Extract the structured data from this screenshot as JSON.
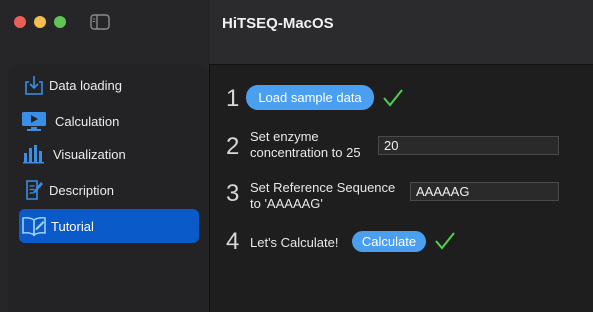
{
  "app": {
    "title": "HiTSEQ-MacOS"
  },
  "sidebar": {
    "items": [
      {
        "label": "Data loading",
        "icon": "download-icon"
      },
      {
        "label": "Calculation",
        "icon": "monitor-play-icon"
      },
      {
        "label": "Visualization",
        "icon": "bar-chart-icon"
      },
      {
        "label": "Description",
        "icon": "document-edit-icon"
      },
      {
        "label": "Tutorial",
        "icon": "open-book-icon",
        "active": true
      }
    ]
  },
  "steps": [
    {
      "number": "1",
      "button_label": "Load sample data",
      "done": true
    },
    {
      "number": "2",
      "text_line1": "Set enzyme",
      "text_line2": "concentration to 25",
      "input_value": "20"
    },
    {
      "number": "3",
      "text_line1": "Set Reference Sequence",
      "text_line2": "to 'AAAAAG'",
      "input_value": "AAAAAG"
    },
    {
      "number": "4",
      "text": "Let's Calculate!",
      "button_label": "Calculate",
      "done": true
    }
  ],
  "colors": {
    "accent": "#0b5ac9",
    "button": "#4a9ff0",
    "check": "#4fd04f",
    "icon": "#3a8ee6"
  }
}
